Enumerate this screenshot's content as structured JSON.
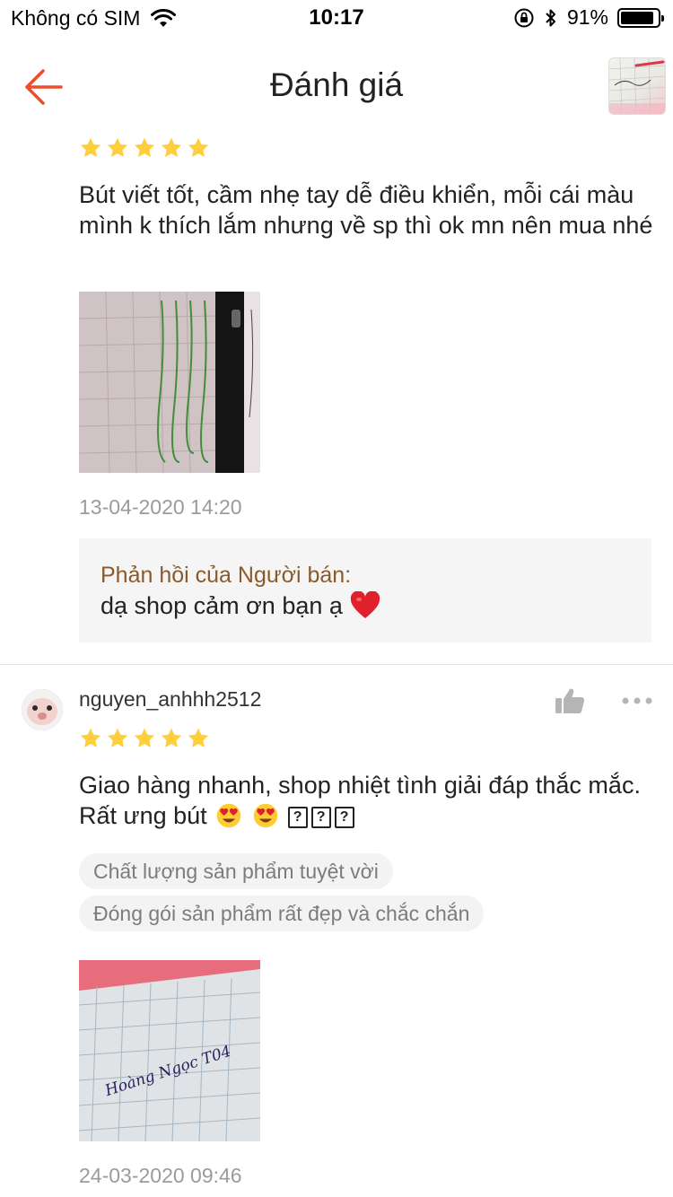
{
  "status_bar": {
    "carrier": "Không có SIM",
    "time": "10:17",
    "battery_percent": "91%",
    "battery_level": 0.91
  },
  "nav": {
    "title": "Đánh giá"
  },
  "reviews": [
    {
      "rating": 5,
      "text": "Bút viết tốt, cầm nhẹ tay dễ điều khiển, mỗi cái màu mình k thích lắm nhưng về sp thì ok mn nên mua nhé",
      "date": "13-04-2020 14:20",
      "seller_reply_label": "Phản hồi của Người bán:",
      "seller_reply_text": "dạ shop cảm ơn bạn ạ"
    },
    {
      "username": "nguyen_anhhh2512",
      "rating": 5,
      "text": "Giao hàng nhanh, shop nhiệt tình giải đáp thắc mắc. Rất ưng bút",
      "tags": [
        "Chất lượng sản phẩm tuyệt vời",
        "Đóng gói sản phẩm rất đẹp và chắc chắn"
      ],
      "photo_caption": "Hoàng Ngọc T04",
      "date": "24-03-2020 09:46"
    }
  ],
  "colors": {
    "accent": "#ee4d2d",
    "star": "#ffce3d",
    "reply_label": "#8a5a2d",
    "muted": "#9b9b9b"
  }
}
